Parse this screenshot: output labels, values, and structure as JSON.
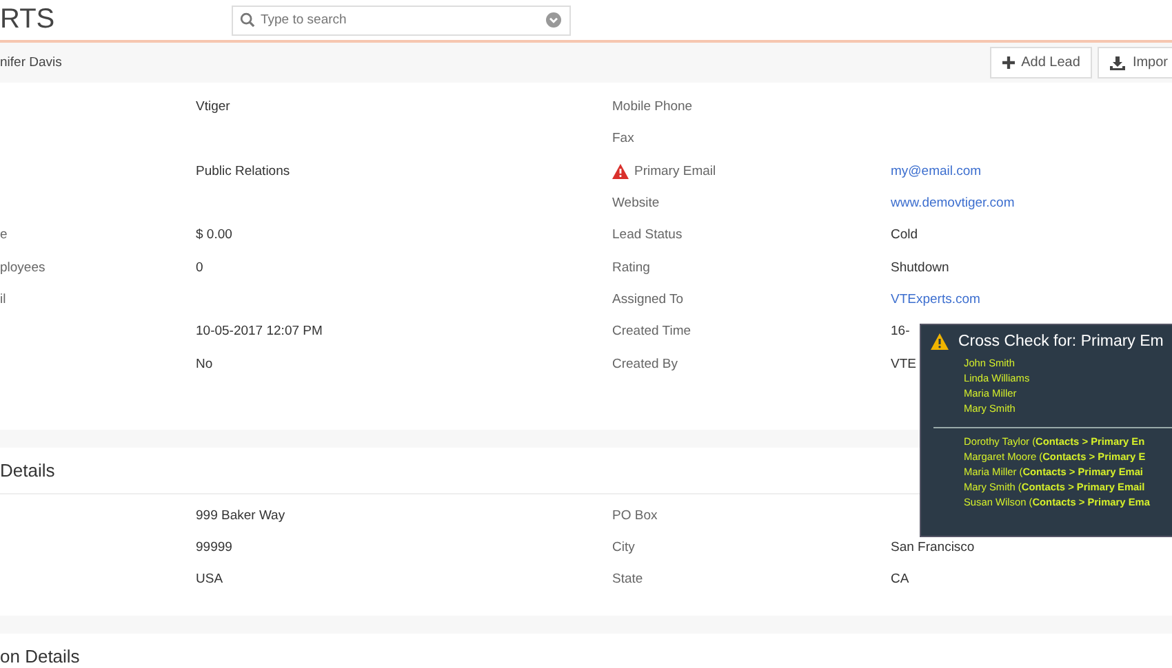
{
  "header": {
    "logo": "RTS",
    "search": {
      "placeholder": "Type to search"
    }
  },
  "subheader": {
    "breadcrumb": "nifer Davis",
    "buttons": [
      {
        "label": "Add Lead",
        "kind": "add"
      },
      {
        "label": "Impor",
        "kind": "import"
      }
    ]
  },
  "details": [
    {
      "value": "Vtiger",
      "label_2": "Mobile Phone"
    },
    {
      "label_2": "Fax"
    },
    {
      "value": "Public Relations",
      "label_2": "Primary Email",
      "warning": true,
      "value_2": "my@email.com",
      "link": true
    },
    {
      "label_2": "Website",
      "value_2": "www.demovtiger.com",
      "link": true
    },
    {
      "label": "e",
      "value": "$ 0.00",
      "label_2": "Lead Status",
      "value_2": "Cold",
      "link": false
    },
    {
      "label": "ployees",
      "value": "0",
      "label_2": "Rating",
      "value_2": "Shutdown",
      "link": false
    },
    {
      "label": "il",
      "label_2": "Assigned To",
      "value_2": "VTExperts.com",
      "link": true
    },
    {
      "value": "10-05-2017 12:07 PM",
      "label_2": "Created Time",
      "value_2": "16-",
      "link": false
    },
    {
      "value": "No",
      "label_2": "Created By",
      "value_2": "VTE",
      "link": false
    }
  ],
  "address_section": {
    "title": "Details",
    "rows": [
      {
        "value": "999 Baker Way",
        "label_2": "PO Box"
      },
      {
        "value": "99999",
        "label_2": "City",
        "value_2": "San Francisco"
      },
      {
        "value": "USA",
        "label_2": "State",
        "value_2": "CA"
      }
    ]
  },
  "next_section": {
    "title": "on Details"
  },
  "popup": {
    "title": "Cross Check for: Primary Em",
    "names": [
      "John Smith",
      "Linda Williams",
      "Maria Miller",
      "Mary Smith"
    ],
    "matches": [
      "Dorothy Taylor (**Contacts > Primary En**",
      "Margaret Moore (**Contacts > Primary E**",
      "Maria Miller (**Contacts > Primary Emai**",
      "Mary Smith (**Contacts > Primary Email**",
      "Susan Wilson (**Contacts > Primary Ema**"
    ]
  }
}
